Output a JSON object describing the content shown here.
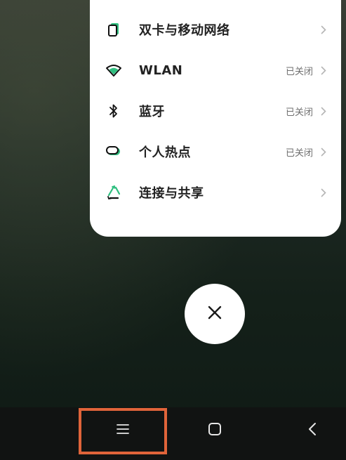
{
  "settings_panel": {
    "items": [
      {
        "label": "双卡与移动网络",
        "status": "",
        "icon": "sim-card-icon"
      },
      {
        "label": "WLAN",
        "status": "已关闭",
        "icon": "wifi-icon"
      },
      {
        "label": "蓝牙",
        "status": "已关闭",
        "icon": "bluetooth-icon"
      },
      {
        "label": "个人热点",
        "status": "已关闭",
        "icon": "hotspot-icon"
      },
      {
        "label": "连接与共享",
        "status": "",
        "icon": "connection-sharing-icon"
      }
    ]
  },
  "close_button": {
    "icon": "close-icon"
  },
  "nav_bar": {
    "menu_icon": "menu-icon",
    "home_icon": "home-icon",
    "back_icon": "back-icon",
    "highlight_color": "#e0643a"
  },
  "colors": {
    "accent": "#2fbf7f",
    "panel_bg": "#ffffff",
    "nav_bg": "#111312"
  }
}
